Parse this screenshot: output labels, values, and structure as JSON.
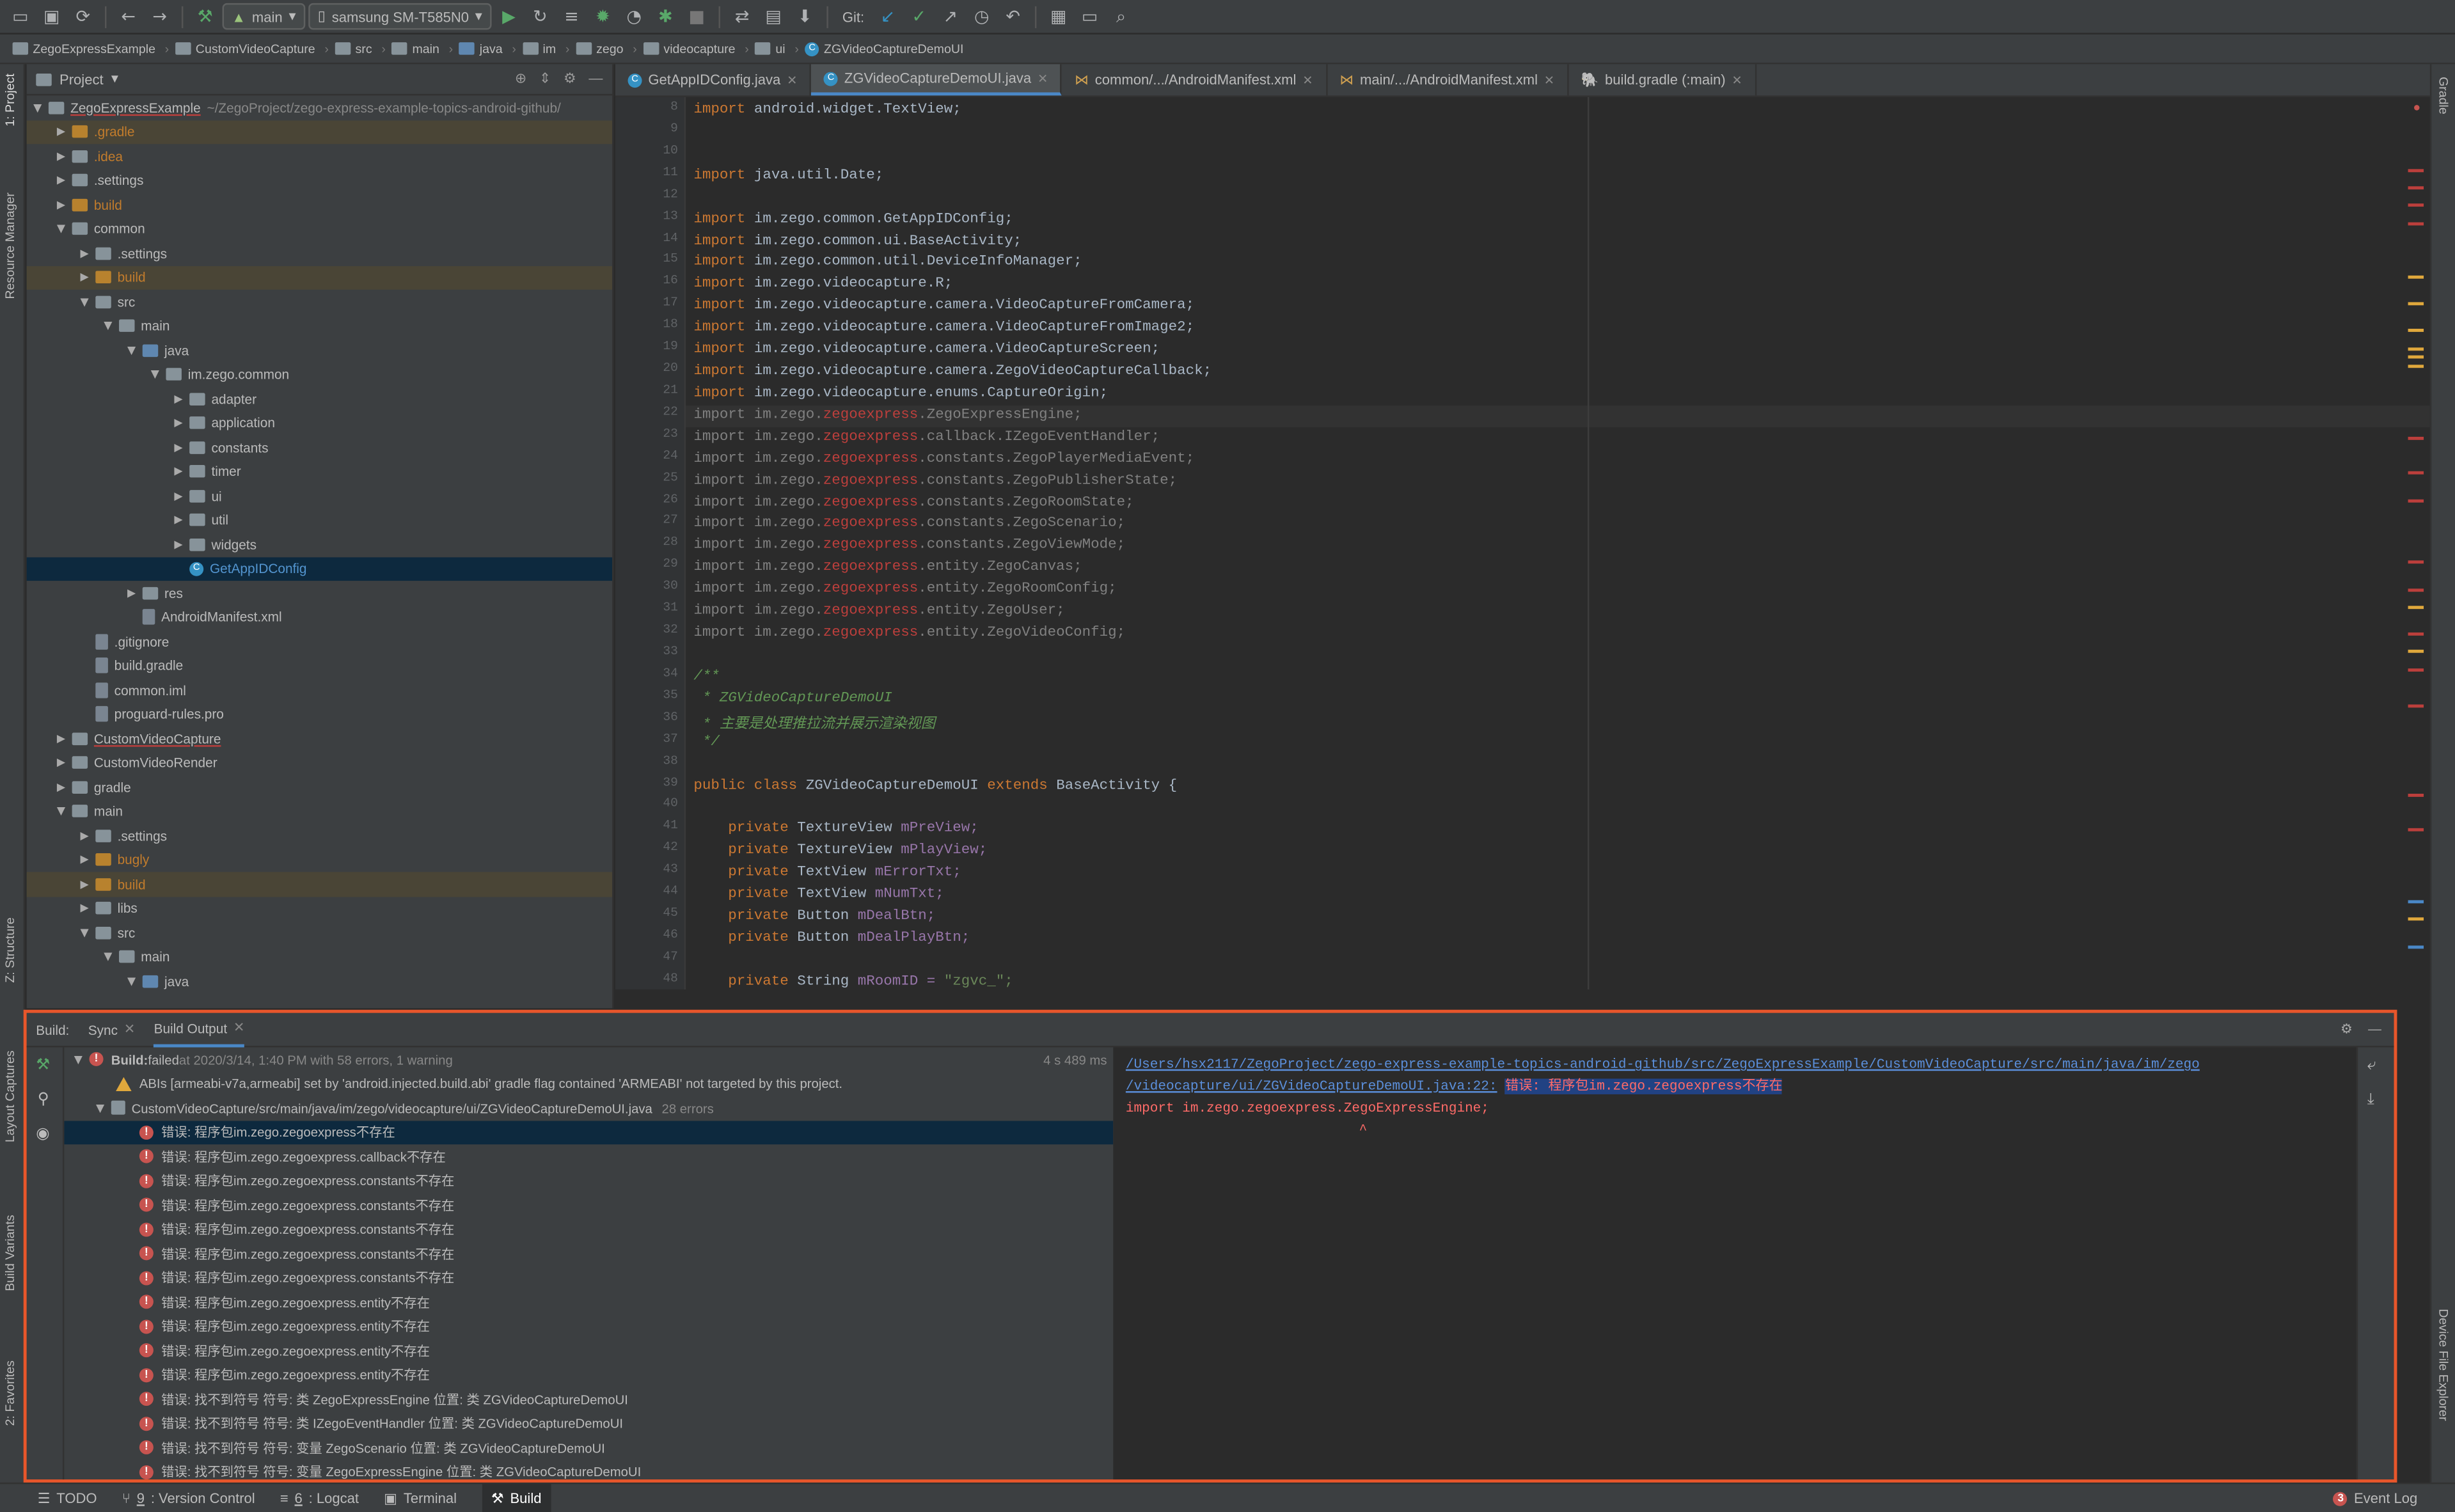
{
  "toolbar": {
    "config": "main",
    "device": "samsung SM-T585N0",
    "git_label": "Git:"
  },
  "breadcrumbs": [
    "ZegoExpressExample",
    "CustomVideoCapture",
    "src",
    "main",
    "java",
    "im",
    "zego",
    "videocapture",
    "ui",
    "ZGVideoCaptureDemoUI"
  ],
  "project": {
    "title": "Project",
    "root": "ZegoExpressExample",
    "root_path": "~/ZegoProject/zego-express-example-topics-android-github/",
    "rows": [
      {
        "label": ".gradle",
        "indent": 1,
        "open": false,
        "kind": "folder-orange",
        "orange": true,
        "hl": true
      },
      {
        "label": ".idea",
        "indent": 1,
        "open": false,
        "kind": "folder-grey",
        "orange": true
      },
      {
        "label": ".settings",
        "indent": 1,
        "open": false,
        "kind": "folder-grey"
      },
      {
        "label": "build",
        "indent": 1,
        "open": false,
        "kind": "folder-orange",
        "orange": true
      },
      {
        "label": "common",
        "indent": 1,
        "open": true,
        "kind": "folder-grey"
      },
      {
        "label": ".settings",
        "indent": 2,
        "open": false,
        "kind": "folder-grey"
      },
      {
        "label": "build",
        "indent": 2,
        "open": false,
        "kind": "folder-orange",
        "orange": true,
        "hl": true
      },
      {
        "label": "src",
        "indent": 2,
        "open": true,
        "kind": "folder-grey"
      },
      {
        "label": "main",
        "indent": 3,
        "open": true,
        "kind": "folder-grey"
      },
      {
        "label": "java",
        "indent": 4,
        "open": true,
        "kind": "folder-blue"
      },
      {
        "label": "im.zego.common",
        "indent": 5,
        "open": true,
        "kind": "folder-grey"
      },
      {
        "label": "adapter",
        "indent": 6,
        "open": false,
        "kind": "folder-grey"
      },
      {
        "label": "application",
        "indent": 6,
        "open": false,
        "kind": "folder-grey"
      },
      {
        "label": "constants",
        "indent": 6,
        "open": false,
        "kind": "folder-grey"
      },
      {
        "label": "timer",
        "indent": 6,
        "open": false,
        "kind": "folder-grey"
      },
      {
        "label": "ui",
        "indent": 6,
        "open": false,
        "kind": "folder-grey"
      },
      {
        "label": "util",
        "indent": 6,
        "open": false,
        "kind": "folder-grey"
      },
      {
        "label": "widgets",
        "indent": 6,
        "open": false,
        "kind": "folder-grey"
      },
      {
        "label": "GetAppIDConfig",
        "indent": 6,
        "leaf": true,
        "kind": "class",
        "sel": true
      },
      {
        "label": "res",
        "indent": 4,
        "open": false,
        "kind": "folder-grey"
      },
      {
        "label": "AndroidManifest.xml",
        "indent": 4,
        "leaf": true,
        "kind": "file"
      },
      {
        "label": ".gitignore",
        "indent": 2,
        "leaf": true,
        "kind": "file"
      },
      {
        "label": "build.gradle",
        "indent": 2,
        "leaf": true,
        "kind": "file"
      },
      {
        "label": "common.iml",
        "indent": 2,
        "leaf": true,
        "kind": "file"
      },
      {
        "label": "proguard-rules.pro",
        "indent": 2,
        "leaf": true,
        "kind": "file"
      },
      {
        "label": "CustomVideoCapture",
        "indent": 1,
        "open": false,
        "kind": "folder-grey",
        "err": true
      },
      {
        "label": "CustomVideoRender",
        "indent": 1,
        "open": false,
        "kind": "folder-grey"
      },
      {
        "label": "gradle",
        "indent": 1,
        "open": false,
        "kind": "folder-grey"
      },
      {
        "label": "main",
        "indent": 1,
        "open": true,
        "kind": "folder-grey"
      },
      {
        "label": ".settings",
        "indent": 2,
        "open": false,
        "kind": "folder-grey"
      },
      {
        "label": "bugly",
        "indent": 2,
        "open": false,
        "kind": "folder-orange",
        "orange": true
      },
      {
        "label": "build",
        "indent": 2,
        "open": false,
        "kind": "folder-orange",
        "orange": true,
        "hl": true
      },
      {
        "label": "libs",
        "indent": 2,
        "open": false,
        "kind": "folder-grey"
      },
      {
        "label": "src",
        "indent": 2,
        "open": true,
        "kind": "folder-grey"
      },
      {
        "label": "main",
        "indent": 3,
        "open": true,
        "kind": "folder-grey"
      },
      {
        "label": "java",
        "indent": 4,
        "open": true,
        "kind": "folder-blue"
      }
    ]
  },
  "left_tabs": [
    "1: Project",
    "Resource Manager",
    "Z: Structure",
    "Layout Captures",
    "Build Variants",
    "2: Favorites"
  ],
  "right_tabs": [
    "Gradle",
    "Device File Explorer"
  ],
  "editor_tabs": [
    {
      "label": "GetAppIDConfig.java",
      "active": false,
      "icon": "class"
    },
    {
      "label": "ZGVideoCaptureDemoUI.java",
      "active": true,
      "icon": "class"
    },
    {
      "label": "common/.../AndroidManifest.xml",
      "active": false,
      "icon": "xml"
    },
    {
      "label": "main/.../AndroidManifest.xml",
      "active": false,
      "icon": "xml"
    },
    {
      "label": "build.gradle (:main)",
      "active": false,
      "icon": "gradle"
    }
  ],
  "code": [
    {
      "n": "8",
      "t": "import android.widget.TextView;"
    },
    {
      "n": "9",
      "t": ""
    },
    {
      "n": "10",
      "t": ""
    },
    {
      "n": "11",
      "t": "import java.util.Date;"
    },
    {
      "n": "12",
      "t": ""
    },
    {
      "n": "13",
      "t": "import im.zego.common.GetAppIDConfig;"
    },
    {
      "n": "14",
      "t": "import im.zego.common.ui.BaseActivity;"
    },
    {
      "n": "15",
      "t": "import im.zego.common.util.DeviceInfoManager;"
    },
    {
      "n": "16",
      "t": "import im.zego.videocapture.R;"
    },
    {
      "n": "17",
      "t": "import im.zego.videocapture.camera.VideoCaptureFromCamera;"
    },
    {
      "n": "18",
      "t": "import im.zego.videocapture.camera.VideoCaptureFromImage2;"
    },
    {
      "n": "19",
      "t": "import im.zego.videocapture.camera.VideoCaptureScreen;"
    },
    {
      "n": "20",
      "t": "import im.zego.videocapture.camera.ZegoVideoCaptureCallback;"
    },
    {
      "n": "21",
      "t": "import im.zego.videocapture.enums.CaptureOrigin;"
    },
    {
      "n": "22",
      "a": "import im.zego.",
      "b": "zegoexpress",
      ".": "",
      "c": ".ZegoExpressEngine;",
      "err": true
    },
    {
      "n": "23",
      "a": "import im.zego.",
      "b": "zegoexpress",
      "c": ".callback.IZegoEventHandler;",
      "err": true
    },
    {
      "n": "24",
      "a": "import im.zego.",
      "b": "zegoexpress",
      "c": ".constants.ZegoPlayerMediaEvent;",
      "err": true
    },
    {
      "n": "25",
      "a": "import im.zego.",
      "b": "zegoexpress",
      "c": ".constants.ZegoPublisherState;",
      "err": true
    },
    {
      "n": "26",
      "a": "import im.zego.",
      "b": "zegoexpress",
      "c": ".constants.ZegoRoomState;",
      "err": true
    },
    {
      "n": "27",
      "a": "import im.zego.",
      "b": "zegoexpress",
      "c": ".constants.ZegoScenario;",
      "err": true
    },
    {
      "n": "28",
      "a": "import im.zego.",
      "b": "zegoexpress",
      "c": ".constants.ZegoViewMode;",
      "err": true
    },
    {
      "n": "29",
      "a": "import im.zego.",
      "b": "zegoexpress",
      "c": ".entity.ZegoCanvas;",
      "err": true
    },
    {
      "n": "30",
      "a": "import im.zego.",
      "b": "zegoexpress",
      "c": ".entity.ZegoRoomConfig;",
      "err": true
    },
    {
      "n": "31",
      "a": "import im.zego.",
      "b": "zegoexpress",
      "c": ".entity.ZegoUser;",
      "err": true
    },
    {
      "n": "32",
      "a": "import im.zego.",
      "b": "zegoexpress",
      "c": ".entity.ZegoVideoConfig;",
      "err": true
    },
    {
      "n": "33",
      "t": ""
    },
    {
      "n": "34",
      "com": "/**"
    },
    {
      "n": "35",
      "com": " * ZGVideoCaptureDemoUI"
    },
    {
      "n": "36",
      "com": " * 主要是处理推拉流并展示渲染视图"
    },
    {
      "n": "37",
      "com": " */"
    },
    {
      "n": "38",
      "t": ""
    },
    {
      "n": "39",
      "cls": true,
      "pre": "public class ",
      "name": "ZGVideoCaptureDemoUI ",
      "ext": "extends ",
      "base": "BaseActivity {"
    },
    {
      "n": "40",
      "t": ""
    },
    {
      "n": "41",
      "kw": "    private ",
      "rest": "TextureView ",
      "var": "mPreView;"
    },
    {
      "n": "42",
      "kw": "    private ",
      "rest": "TextureView ",
      "var": "mPlayView;"
    },
    {
      "n": "43",
      "kw": "    private ",
      "rest": "TextView ",
      "var": "mErrorTxt;"
    },
    {
      "n": "44",
      "kw": "    private ",
      "rest": "TextView ",
      "var": "mNumTxt;"
    },
    {
      "n": "45",
      "kw": "    private ",
      "rest": "Button ",
      "var": "mDealBtn;"
    },
    {
      "n": "46",
      "kw": "    private ",
      "rest": "Button ",
      "var": "mDealPlayBtn;"
    },
    {
      "n": "47",
      "t": ""
    },
    {
      "n": "48",
      "kw": "    private ",
      "rest": "String ",
      "var": "mRoomID = ",
      "s": "\"zgvc_\";"
    }
  ],
  "build": {
    "tabs": {
      "build": "Build:",
      "sync": "Sync",
      "output": "Build Output"
    },
    "summary_bold": "Build:",
    "summary_status": " failed",
    "summary_rest": " at 2020/3/14, 1:40 PM with 58 errors, 1 warning",
    "summary_time": "4 s 489 ms",
    "warning": "ABIs [armeabi-v7a,armeabi] set by 'android.injected.build.abi' gradle flag contained 'ARMEABI' not targeted by this project.",
    "file": "CustomVideoCapture/src/main/java/im/zego/videocapture/ui/ZGVideoCaptureDemoUI.java",
    "file_count": "28 errors",
    "errors": [
      "错误: 程序包im.zego.zegoexpress不存在",
      "错误: 程序包im.zego.zegoexpress.callback不存在",
      "错误: 程序包im.zego.zegoexpress.constants不存在",
      "错误: 程序包im.zego.zegoexpress.constants不存在",
      "错误: 程序包im.zego.zegoexpress.constants不存在",
      "错误: 程序包im.zego.zegoexpress.constants不存在",
      "错误: 程序包im.zego.zegoexpress.constants不存在",
      "错误: 程序包im.zego.zegoexpress.entity不存在",
      "错误: 程序包im.zego.zegoexpress.entity不存在",
      "错误: 程序包im.zego.zegoexpress.entity不存在",
      "错误: 程序包im.zego.zegoexpress.entity不存在",
      "错误: 找不到符号 符号:   类 ZegoExpressEngine 位置: 类 ZGVideoCaptureDemoUI",
      "错误: 找不到符号 符号:   类 IZegoEventHandler 位置: 类 ZGVideoCaptureDemoUI",
      "错误: 找不到符号 符号:   变量 ZegoScenario 位置: 类 ZGVideoCaptureDemoUI",
      "错误: 找不到符号 符号:   变量 ZegoExpressEngine 位置: 类 ZGVideoCaptureDemoUI"
    ],
    "console_path1": "/Users/hsx2117/ZegoProject/zego-express-example-topics-android-github/src/ZegoExpressExample/CustomVideoCapture/src/main/java/im/zego",
    "console_path2": "/videocapture/ui/ZGVideoCaptureDemoUI.java:22:",
    "console_err": "错误: 程序包im.zego.zegoexpress不存在",
    "console_code": "import im.zego.zegoexpress.ZegoExpressEngine;",
    "console_caret": "^"
  },
  "status": {
    "items": [
      {
        "n": "",
        "label": "TODO"
      },
      {
        "n": "9",
        "label": ": Version Control"
      },
      {
        "n": "6",
        "label": ": Logcat"
      },
      {
        "n": "",
        "label": "Terminal"
      },
      {
        "n": "",
        "label": "Build"
      }
    ],
    "event_count": "3",
    "event_log": "Event Log"
  }
}
